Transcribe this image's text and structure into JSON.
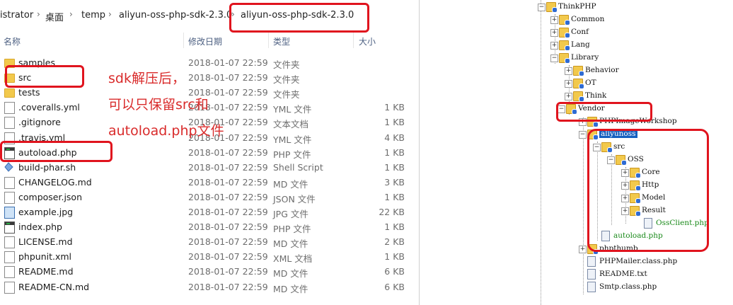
{
  "explorer": {
    "breadcrumb": [
      "istrator",
      "桌面",
      "temp",
      "aliyun-oss-php-sdk-2.3.0",
      "aliyun-oss-php-sdk-2.3.0"
    ],
    "columns": {
      "name": "名称",
      "date": "修改日期",
      "type": "类型",
      "size": "大小"
    },
    "files": [
      {
        "name": "samples",
        "date": "2018-01-07 22:59",
        "type": "文件夹",
        "size": "",
        "icon": "folder-icon"
      },
      {
        "name": "src",
        "date": "2018-01-07 22:59",
        "type": "文件夹",
        "size": "",
        "icon": "folder-icon"
      },
      {
        "name": "tests",
        "date": "2018-01-07 22:59",
        "type": "文件夹",
        "size": "",
        "icon": "folder-icon"
      },
      {
        "name": ".coveralls.yml",
        "date": "2018-01-07 22:59",
        "type": "YML 文件",
        "size": "1 KB",
        "icon": "document-icon"
      },
      {
        "name": ".gitignore",
        "date": "2018-01-07 22:59",
        "type": "文本文档",
        "size": "1 KB",
        "icon": "document-icon"
      },
      {
        "name": ".travis.yml",
        "date": "2018-01-07 22:59",
        "type": "YML 文件",
        "size": "4 KB",
        "icon": "document-icon"
      },
      {
        "name": "autoload.php",
        "date": "2018-01-07 22:59",
        "type": "PHP 文件",
        "size": "1 KB",
        "icon": "php-file-icon"
      },
      {
        "name": "build-phar.sh",
        "date": "2018-01-07 22:59",
        "type": "Shell Script",
        "size": "1 KB",
        "icon": "shell-script-icon"
      },
      {
        "name": "CHANGELOG.md",
        "date": "2018-01-07 22:59",
        "type": "MD 文件",
        "size": "3 KB",
        "icon": "document-icon"
      },
      {
        "name": "composer.json",
        "date": "2018-01-07 22:59",
        "type": "JSON 文件",
        "size": "1 KB",
        "icon": "document-icon"
      },
      {
        "name": "example.jpg",
        "date": "2018-01-07 22:59",
        "type": "JPG 文件",
        "size": "22 KB",
        "icon": "image-icon"
      },
      {
        "name": "index.php",
        "date": "2018-01-07 22:59",
        "type": "PHP 文件",
        "size": "1 KB",
        "icon": "php-file-icon"
      },
      {
        "name": "LICENSE.md",
        "date": "2018-01-07 22:59",
        "type": "MD 文件",
        "size": "2 KB",
        "icon": "document-icon"
      },
      {
        "name": "phpunit.xml",
        "date": "2018-01-07 22:59",
        "type": "XML 文档",
        "size": "1 KB",
        "icon": "document-icon"
      },
      {
        "name": "README.md",
        "date": "2018-01-07 22:59",
        "type": "MD 文件",
        "size": "6 KB",
        "icon": "document-icon"
      },
      {
        "name": "README-CN.md",
        "date": "2018-01-07 22:59",
        "type": "MD 文件",
        "size": "6 KB",
        "icon": "document-icon"
      }
    ],
    "annotation": [
      "sdk解压后，",
      "可以只保留src和",
      "autoload.php文件"
    ]
  },
  "tree": {
    "nodes": [
      {
        "label": "ThinkPHP",
        "kind": "folder"
      },
      {
        "label": "Common",
        "kind": "folder"
      },
      {
        "label": "Conf",
        "kind": "folder"
      },
      {
        "label": "Lang",
        "kind": "folder"
      },
      {
        "label": "Library",
        "kind": "folder"
      },
      {
        "label": "Behavior",
        "kind": "folder"
      },
      {
        "label": "OT",
        "kind": "folder"
      },
      {
        "label": "Think",
        "kind": "folder"
      },
      {
        "label": "Vendor",
        "kind": "folder"
      },
      {
        "label": "PHPImageWorkshop",
        "kind": "folder"
      },
      {
        "label": "aliyunoss",
        "kind": "folder"
      },
      {
        "label": "src",
        "kind": "folder"
      },
      {
        "label": "OSS",
        "kind": "folder"
      },
      {
        "label": "Core",
        "kind": "folder"
      },
      {
        "label": "Http",
        "kind": "folder"
      },
      {
        "label": "Model",
        "kind": "folder"
      },
      {
        "label": "Result",
        "kind": "folder"
      },
      {
        "label": "OssClient.php",
        "kind": "file"
      },
      {
        "label": "autoload.php",
        "kind": "file"
      },
      {
        "label": "phpthumb",
        "kind": "folder"
      },
      {
        "label": "PHPMailer.class.php",
        "kind": "file"
      },
      {
        "label": "README.txt",
        "kind": "file"
      },
      {
        "label": "Smtp.class.php",
        "kind": "file"
      }
    ]
  },
  "colors": {
    "annotation": "#e0141e",
    "annotation_text": "#d92b2b",
    "selection": "#1560c0",
    "highlight_text": "#1a8a1a"
  }
}
